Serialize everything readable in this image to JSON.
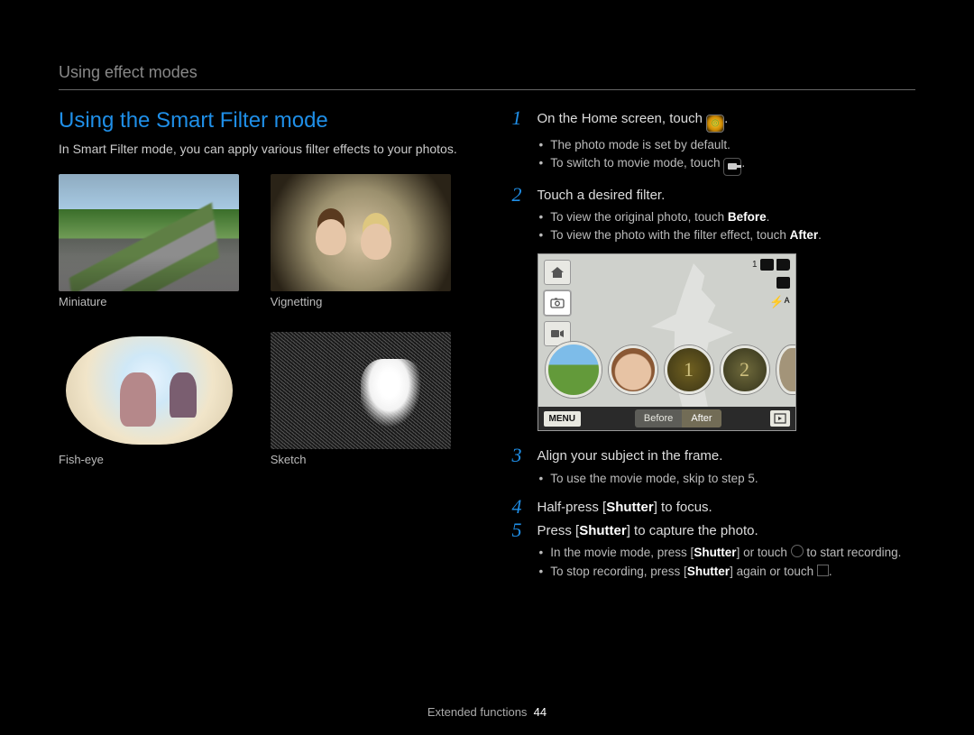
{
  "breadcrumb": "Using effect modes",
  "section_title": "Using the Smart Filter mode",
  "intro": "In Smart Filter mode, you can apply various filter effects to your photos.",
  "filters": {
    "miniature": "Miniature",
    "vignetting": "Vignetting",
    "fisheye": "Fish-eye",
    "sketch": "Sketch"
  },
  "steps": {
    "s1": {
      "num": "1",
      "text_a": "On the Home screen, touch ",
      "text_b": "."
    },
    "s1_sub": {
      "a": "The photo mode is set by default.",
      "b_a": "To switch to movie mode, touch ",
      "b_b": "."
    },
    "s2": {
      "num": "2",
      "text": "Touch a desired filter."
    },
    "s2_sub": {
      "a_a": "To view the original photo, touch ",
      "a_bold": "Before",
      "a_b": ".",
      "b_a": "To view the photo with the filter effect, touch ",
      "b_bold": "After",
      "b_b": "."
    },
    "s3": {
      "num": "3",
      "text": "Align your subject in the frame."
    },
    "s3_sub": {
      "a": "To use the movie mode, skip to step 5."
    },
    "s4": {
      "num": "4",
      "text_a": "Half-press [",
      "text_bold": "Shutter",
      "text_b": "] to focus."
    },
    "s5": {
      "num": "5",
      "text_a": "Press [",
      "text_bold": "Shutter",
      "text_b": "] to capture the photo."
    },
    "s5_sub": {
      "a_a": "In the movie mode,  press [",
      "a_bold": "Shutter",
      "a_b": "] or touch ",
      "a_c": " to start recording.",
      "b_a": "To stop recording, press [",
      "b_bold": "Shutter",
      "b_b": "] again or touch ",
      "b_c": "."
    }
  },
  "camera_preview": {
    "counter": "1",
    "menu": "MENU",
    "before": "Before",
    "after": "After",
    "flash": "⚡ᴬ",
    "filter_numbers": {
      "n1": "1",
      "n2": "2"
    }
  },
  "footer": {
    "label": "Extended functions",
    "page": "44"
  }
}
